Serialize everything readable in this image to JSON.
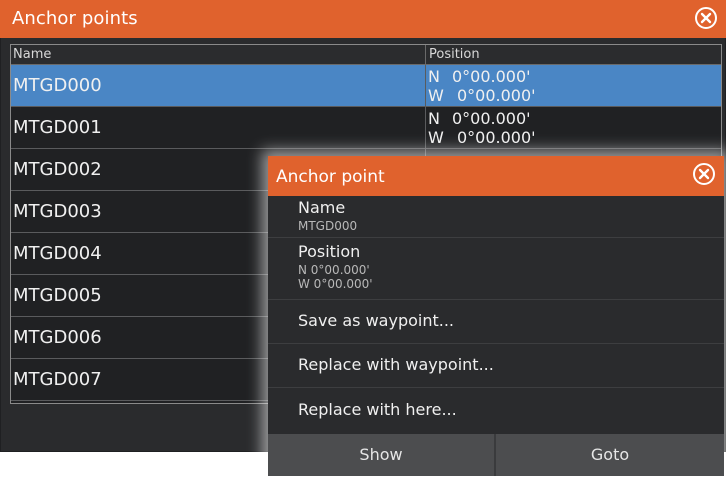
{
  "window": {
    "title": "Anchor points",
    "close_icon": "close-circle-icon"
  },
  "table": {
    "columns": [
      "Name",
      "Position"
    ],
    "rows": [
      {
        "name": "MTGD000",
        "lat_dir": "N",
        "lat": "0°00.000'",
        "lon_dir": "W",
        "lon": "0°00.000'",
        "selected": true
      },
      {
        "name": "MTGD001",
        "lat_dir": "N",
        "lat": "0°00.000'",
        "lon_dir": "W",
        "lon": "0°00.000'",
        "selected": false
      },
      {
        "name": "MTGD002",
        "lat_dir": "",
        "lat": "",
        "lon_dir": "",
        "lon": "",
        "selected": false
      },
      {
        "name": "MTGD003",
        "lat_dir": "",
        "lat": "",
        "lon_dir": "",
        "lon": "",
        "selected": false
      },
      {
        "name": "MTGD004",
        "lat_dir": "",
        "lat": "",
        "lon_dir": "",
        "lon": "",
        "selected": false
      },
      {
        "name": "MTGD005",
        "lat_dir": "",
        "lat": "",
        "lon_dir": "",
        "lon": "",
        "selected": false
      },
      {
        "name": "MTGD006",
        "lat_dir": "",
        "lat": "",
        "lon_dir": "",
        "lon": "",
        "selected": false
      },
      {
        "name": "MTGD007",
        "lat_dir": "",
        "lat": "",
        "lon_dir": "",
        "lon": "",
        "selected": false
      }
    ]
  },
  "dialog": {
    "title": "Anchor point",
    "close_icon": "close-circle-icon",
    "name_label": "Name",
    "name_value": "MTGD000",
    "position_label": "Position",
    "position_lat": "N   0°00.000'",
    "position_lon": "W   0°00.000'",
    "menu": [
      "Save as waypoint...",
      "Replace with waypoint...",
      "Replace with here..."
    ],
    "buttons": {
      "show": "Show",
      "goto": "Goto"
    }
  },
  "colors": {
    "title_bar": "#e0622d",
    "selected_row": "#4a86c5",
    "background": "#202123",
    "dialog_button_bar": "#4c4d4f"
  }
}
